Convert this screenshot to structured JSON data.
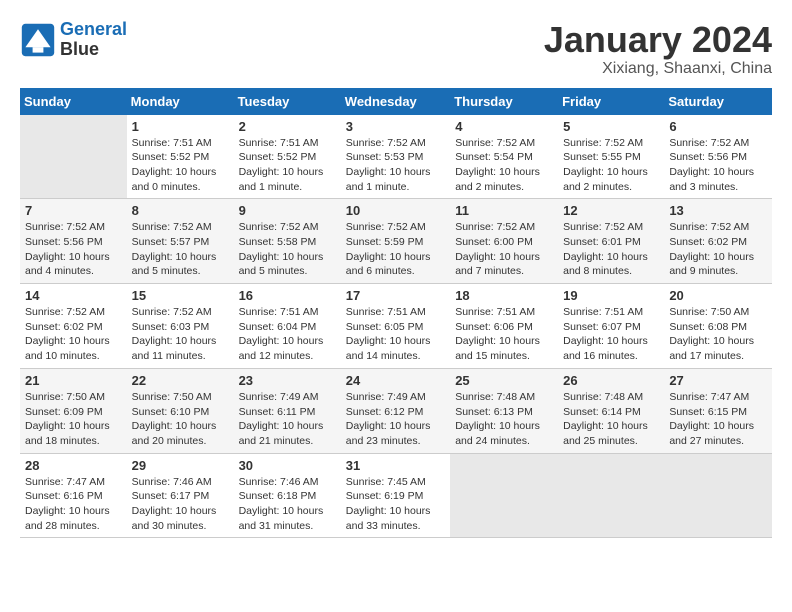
{
  "header": {
    "logo_line1": "General",
    "logo_line2": "Blue",
    "month": "January 2024",
    "location": "Xixiang, Shaanxi, China"
  },
  "days_of_week": [
    "Sunday",
    "Monday",
    "Tuesday",
    "Wednesday",
    "Thursday",
    "Friday",
    "Saturday"
  ],
  "weeks": [
    [
      {
        "day": "",
        "info": ""
      },
      {
        "day": "1",
        "info": "Sunrise: 7:51 AM\nSunset: 5:52 PM\nDaylight: 10 hours\nand 0 minutes."
      },
      {
        "day": "2",
        "info": "Sunrise: 7:51 AM\nSunset: 5:52 PM\nDaylight: 10 hours\nand 1 minute."
      },
      {
        "day": "3",
        "info": "Sunrise: 7:52 AM\nSunset: 5:53 PM\nDaylight: 10 hours\nand 1 minute."
      },
      {
        "day": "4",
        "info": "Sunrise: 7:52 AM\nSunset: 5:54 PM\nDaylight: 10 hours\nand 2 minutes."
      },
      {
        "day": "5",
        "info": "Sunrise: 7:52 AM\nSunset: 5:55 PM\nDaylight: 10 hours\nand 2 minutes."
      },
      {
        "day": "6",
        "info": "Sunrise: 7:52 AM\nSunset: 5:56 PM\nDaylight: 10 hours\nand 3 minutes."
      }
    ],
    [
      {
        "day": "7",
        "info": "Sunrise: 7:52 AM\nSunset: 5:56 PM\nDaylight: 10 hours\nand 4 minutes."
      },
      {
        "day": "8",
        "info": "Sunrise: 7:52 AM\nSunset: 5:57 PM\nDaylight: 10 hours\nand 5 minutes."
      },
      {
        "day": "9",
        "info": "Sunrise: 7:52 AM\nSunset: 5:58 PM\nDaylight: 10 hours\nand 5 minutes."
      },
      {
        "day": "10",
        "info": "Sunrise: 7:52 AM\nSunset: 5:59 PM\nDaylight: 10 hours\nand 6 minutes."
      },
      {
        "day": "11",
        "info": "Sunrise: 7:52 AM\nSunset: 6:00 PM\nDaylight: 10 hours\nand 7 minutes."
      },
      {
        "day": "12",
        "info": "Sunrise: 7:52 AM\nSunset: 6:01 PM\nDaylight: 10 hours\nand 8 minutes."
      },
      {
        "day": "13",
        "info": "Sunrise: 7:52 AM\nSunset: 6:02 PM\nDaylight: 10 hours\nand 9 minutes."
      }
    ],
    [
      {
        "day": "14",
        "info": "Sunrise: 7:52 AM\nSunset: 6:02 PM\nDaylight: 10 hours\nand 10 minutes."
      },
      {
        "day": "15",
        "info": "Sunrise: 7:52 AM\nSunset: 6:03 PM\nDaylight: 10 hours\nand 11 minutes."
      },
      {
        "day": "16",
        "info": "Sunrise: 7:51 AM\nSunset: 6:04 PM\nDaylight: 10 hours\nand 12 minutes."
      },
      {
        "day": "17",
        "info": "Sunrise: 7:51 AM\nSunset: 6:05 PM\nDaylight: 10 hours\nand 14 minutes."
      },
      {
        "day": "18",
        "info": "Sunrise: 7:51 AM\nSunset: 6:06 PM\nDaylight: 10 hours\nand 15 minutes."
      },
      {
        "day": "19",
        "info": "Sunrise: 7:51 AM\nSunset: 6:07 PM\nDaylight: 10 hours\nand 16 minutes."
      },
      {
        "day": "20",
        "info": "Sunrise: 7:50 AM\nSunset: 6:08 PM\nDaylight: 10 hours\nand 17 minutes."
      }
    ],
    [
      {
        "day": "21",
        "info": "Sunrise: 7:50 AM\nSunset: 6:09 PM\nDaylight: 10 hours\nand 18 minutes."
      },
      {
        "day": "22",
        "info": "Sunrise: 7:50 AM\nSunset: 6:10 PM\nDaylight: 10 hours\nand 20 minutes."
      },
      {
        "day": "23",
        "info": "Sunrise: 7:49 AM\nSunset: 6:11 PM\nDaylight: 10 hours\nand 21 minutes."
      },
      {
        "day": "24",
        "info": "Sunrise: 7:49 AM\nSunset: 6:12 PM\nDaylight: 10 hours\nand 23 minutes."
      },
      {
        "day": "25",
        "info": "Sunrise: 7:48 AM\nSunset: 6:13 PM\nDaylight: 10 hours\nand 24 minutes."
      },
      {
        "day": "26",
        "info": "Sunrise: 7:48 AM\nSunset: 6:14 PM\nDaylight: 10 hours\nand 25 minutes."
      },
      {
        "day": "27",
        "info": "Sunrise: 7:47 AM\nSunset: 6:15 PM\nDaylight: 10 hours\nand 27 minutes."
      }
    ],
    [
      {
        "day": "28",
        "info": "Sunrise: 7:47 AM\nSunset: 6:16 PM\nDaylight: 10 hours\nand 28 minutes."
      },
      {
        "day": "29",
        "info": "Sunrise: 7:46 AM\nSunset: 6:17 PM\nDaylight: 10 hours\nand 30 minutes."
      },
      {
        "day": "30",
        "info": "Sunrise: 7:46 AM\nSunset: 6:18 PM\nDaylight: 10 hours\nand 31 minutes."
      },
      {
        "day": "31",
        "info": "Sunrise: 7:45 AM\nSunset: 6:19 PM\nDaylight: 10 hours\nand 33 minutes."
      },
      {
        "day": "",
        "info": ""
      },
      {
        "day": "",
        "info": ""
      },
      {
        "day": "",
        "info": ""
      }
    ]
  ]
}
